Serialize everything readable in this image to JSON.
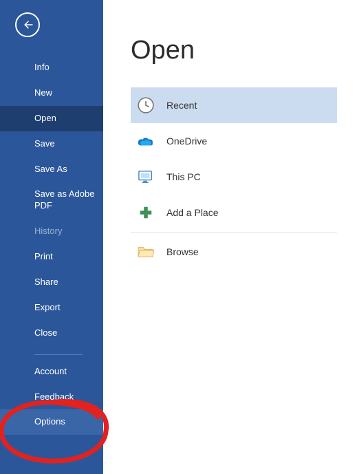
{
  "sidebar": {
    "items": [
      {
        "label": "Info",
        "state": "normal"
      },
      {
        "label": "New",
        "state": "normal"
      },
      {
        "label": "Open",
        "state": "selected"
      },
      {
        "label": "Save",
        "state": "normal"
      },
      {
        "label": "Save As",
        "state": "normal"
      },
      {
        "label": "Save as Adobe PDF",
        "state": "normal"
      },
      {
        "label": "History",
        "state": "disabled"
      },
      {
        "label": "Print",
        "state": "normal"
      },
      {
        "label": "Share",
        "state": "normal"
      },
      {
        "label": "Export",
        "state": "normal"
      },
      {
        "label": "Close",
        "state": "normal"
      }
    ],
    "bottom_items": [
      {
        "label": "Account",
        "state": "normal"
      },
      {
        "label": "Feedback",
        "state": "normal"
      },
      {
        "label": "Options",
        "state": "highlighted"
      }
    ]
  },
  "page": {
    "title": "Open"
  },
  "locations": [
    {
      "label": "Recent",
      "icon": "clock-icon",
      "selected": true
    },
    {
      "label": "OneDrive",
      "icon": "onedrive-icon",
      "selected": false
    },
    {
      "label": "This PC",
      "icon": "thispc-icon",
      "selected": false
    },
    {
      "label": "Add a Place",
      "icon": "addplace-icon",
      "selected": false
    },
    {
      "label": "Browse",
      "icon": "folder-icon",
      "selected": false,
      "divider_before": true
    }
  ]
}
